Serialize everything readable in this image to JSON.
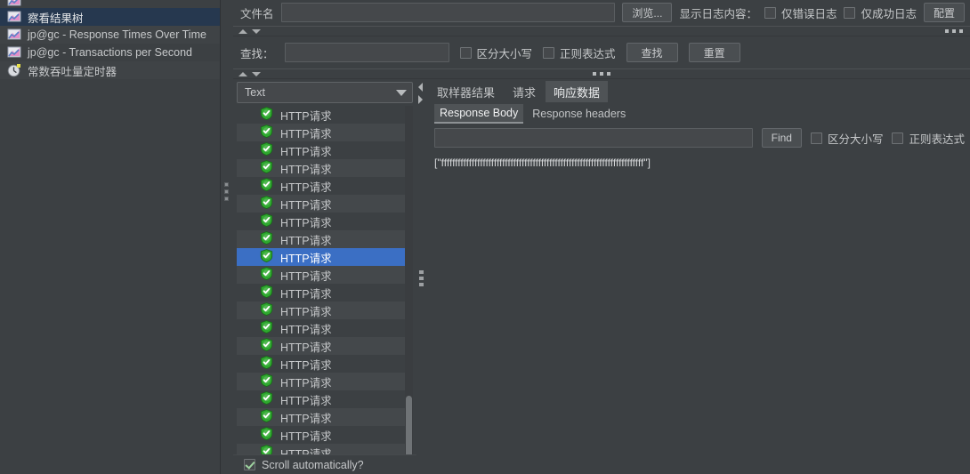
{
  "app": {
    "bg_color": "#3c4043",
    "accent_selection": "#3b6fc4",
    "tree_selection": "#26384f"
  },
  "tree": {
    "items": [
      {
        "label": "",
        "icon": "chart-icon",
        "selected": false,
        "clipped": true,
        "alt": false
      },
      {
        "label": "察看结果树",
        "icon": "chart-icon",
        "selected": true,
        "clipped": false,
        "alt": false
      },
      {
        "label": "jp@gc - Response Times Over Time",
        "icon": "chart-icon",
        "selected": false,
        "clipped": false,
        "alt": true
      },
      {
        "label": "jp@gc - Transactions per Second",
        "icon": "chart-icon",
        "selected": false,
        "clipped": false,
        "alt": false
      },
      {
        "label": "常数吞吐量定时器",
        "icon": "timer-icon",
        "selected": false,
        "clipped": false,
        "alt": true
      }
    ]
  },
  "file_row": {
    "label": "文件名",
    "filename_value": "",
    "filename_placeholder": "",
    "browse_label": "浏览...",
    "log_content_label": "显示日志内容：",
    "errors_only_label": "仅错误日志",
    "errors_only_checked": false,
    "success_only_label": "仅成功日志",
    "success_only_checked": false,
    "configure_label": "配置"
  },
  "find_row": {
    "label": "查找：",
    "value": "",
    "placeholder": "",
    "match_case_label": "区分大小写",
    "match_case_checked": false,
    "regex_label": "正则表达式",
    "regex_checked": false,
    "search_button": "查找",
    "reset_button": "重置"
  },
  "results": {
    "view_type": "Text",
    "row_label": "HTTP请求",
    "row_count": 21,
    "selected_index": 8,
    "icon": "shield-success-icon",
    "scroll_auto_label": "Scroll automatically?",
    "scroll_auto_checked": true
  },
  "detail": {
    "tabs": [
      {
        "label": "取样器结果",
        "active": false
      },
      {
        "label": "请求",
        "active": false
      },
      {
        "label": "响应数据",
        "active": true
      }
    ],
    "subtabs": [
      {
        "label": "Response Body",
        "active": true
      },
      {
        "label": "Response headers",
        "active": false
      }
    ],
    "find": {
      "value": "",
      "placeholder": "",
      "find_button": "Find",
      "match_case_label": "区分大小写",
      "match_case_checked": false,
      "regex_label": "正则表达式",
      "regex_checked": false
    },
    "body_text": "[\"fffffffffffffffffffffffffffffffffffffffffffffffffffffffffffffffffffffffff\"]"
  }
}
